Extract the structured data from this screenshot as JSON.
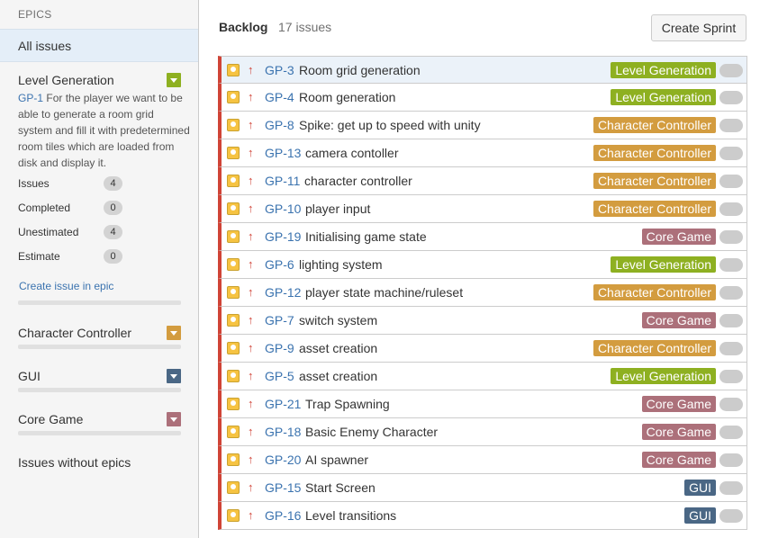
{
  "colors": {
    "level_generation": "#8eb021",
    "character_controller": "#d39c3f",
    "gui": "#4a6785",
    "core_game": "#ac707a",
    "priority_high": "#d04437",
    "link": "#3b73af"
  },
  "sidebar": {
    "title": "EPICS",
    "all_issues": "All issues",
    "level_generation": {
      "name": "Level Generation",
      "key": "GP-1",
      "description": "For the player we want to be able to generate a room grid system and fill it with predetermined room tiles which are loaded from disk and display it.",
      "stats": [
        {
          "label": "Issues",
          "count": "4"
        },
        {
          "label": "Completed",
          "count": "0"
        },
        {
          "label": "Unestimated",
          "count": "4"
        },
        {
          "label": "Estimate",
          "count": "0"
        }
      ],
      "create_link": "Create issue in epic"
    },
    "character_controller": {
      "name": "Character Controller"
    },
    "gui": {
      "name": "GUI"
    },
    "core_game": {
      "name": "Core Game"
    },
    "no_epics": "Issues without epics"
  },
  "backlog": {
    "title": "Backlog",
    "count": "17 issues",
    "create_sprint": "Create Sprint",
    "issues": [
      {
        "key": "GP-3",
        "summary": "Room grid generation",
        "epic": "Level Generation"
      },
      {
        "key": "GP-4",
        "summary": "Room generation",
        "epic": "Level Generation"
      },
      {
        "key": "GP-8",
        "summary": "Spike: get up to speed with unity",
        "epic": "Character Controller"
      },
      {
        "key": "GP-13",
        "summary": "camera contoller",
        "epic": "Character Controller"
      },
      {
        "key": "GP-11",
        "summary": "character controller",
        "epic": "Character Controller"
      },
      {
        "key": "GP-10",
        "summary": "player input",
        "epic": "Character Controller"
      },
      {
        "key": "GP-19",
        "summary": "Initialising game state",
        "epic": "Core Game"
      },
      {
        "key": "GP-6",
        "summary": "lighting system",
        "epic": "Level Generation"
      },
      {
        "key": "GP-12",
        "summary": "player state machine/ruleset",
        "epic": "Character Controller"
      },
      {
        "key": "GP-7",
        "summary": "switch system",
        "epic": "Core Game"
      },
      {
        "key": "GP-9",
        "summary": "asset creation",
        "epic": "Character Controller"
      },
      {
        "key": "GP-5",
        "summary": "asset creation",
        "epic": "Level Generation"
      },
      {
        "key": "GP-21",
        "summary": "Trap Spawning",
        "epic": "Core Game"
      },
      {
        "key": "GP-18",
        "summary": "Basic Enemy Character",
        "epic": "Core Game"
      },
      {
        "key": "GP-20",
        "summary": "AI spawner",
        "epic": "Core Game"
      },
      {
        "key": "GP-15",
        "summary": "Start Screen",
        "epic": "GUI"
      },
      {
        "key": "GP-16",
        "summary": "Level transitions",
        "epic": "GUI"
      }
    ]
  }
}
